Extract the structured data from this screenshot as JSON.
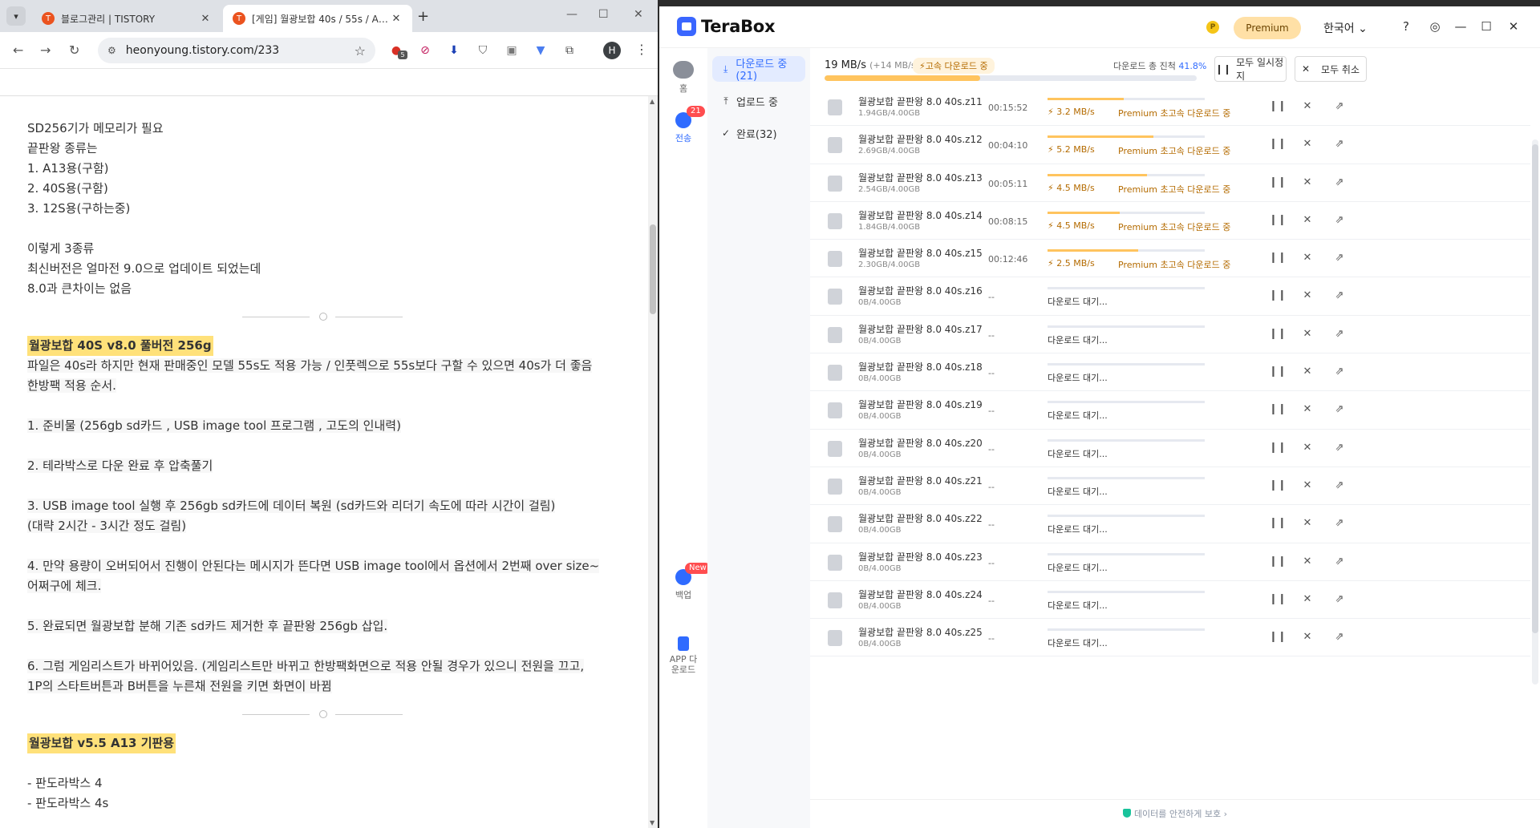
{
  "chrome": {
    "tabs": [
      {
        "label": "블로그관리 | TISTORY",
        "favicon": "T",
        "active": false
      },
      {
        "label": "[게임] 월광보합 40s / 55s / A13 끝판왕 ...",
        "favicon": "T",
        "active": true
      }
    ],
    "url": "heonyoung.tistory.com/233",
    "profile_initial": "H",
    "ext_badge": "5"
  },
  "article": {
    "block1": [
      "SD256기가 메모리가 필요",
      "끝판왕 종류는",
      " 1. A13용(구함)",
      " 2. 40S용(구함)",
      " 3. 12S용(구하는중)",
      "",
      "이렇게 3종류",
      "최신버전은 얼마전 9.0으로 업데이트 되었는데",
      "8.0과 큰차이는 없음"
    ],
    "heading1": "월광보합 40S v8.0 풀버전 256g",
    "block2": [
      "파일은 40s라 하지만 현재 판매중인 모델 55s도 적용 가능 / 인풋렉으로 55s보다 구할 수 있으면 40s가 더 좋음",
      "한방팩 적용 순서.",
      "",
      "1. 준비물 (256gb sd카드 , USB image tool 프로그램 , 고도의 인내력)",
      "",
      "2. 테라박스로 다운 완료 후 압축풀기",
      "",
      "3. USB image tool 실행 후 256gb sd카드에 데이터 복원 (sd카드와 리더기 속도에 따라 시간이 걸림)",
      "(대략 2시간 - 3시간 정도 걸림)",
      "",
      "4. 만약 용량이 오버되어서 진행이 안된다는 메시지가 뜬다면 USB image tool에서 옵션에서 2번째 over size~",
      "어쩌구에 체크.",
      "",
      "5. 완료되면 월광보합 분해 기존 sd카드 제거한 후 끝판왕 256gb 삽입.",
      "",
      "6. 그럼 게임리스트가 바뀌어있음. (게임리스트만 바뀌고 한방팩화면으로 적용 안될 경우가 있으니 전원을 끄고,",
      "1P의 스타트버튼과 B버튼을 누른채 전원을 키면 화면이 바뀜"
    ],
    "heading2": "월광보합 v5.5 A13 기판용",
    "block3": [
      " - 판도라박스 4",
      " - 판도라박스 4s"
    ]
  },
  "terabox": {
    "app_name": "TeraBox",
    "coin_label": "P",
    "premium_label": "Premium",
    "language": "한국어",
    "rail": {
      "home": "홈",
      "transfer": "전송",
      "transfer_badge": "21",
      "backup": "백업",
      "backup_badge": "New",
      "app_download": "APP 다운로드"
    },
    "sidebar": {
      "downloading": "다운로드 중(21)",
      "uploading": "업로드 중",
      "completed": "완료(32)"
    },
    "summary": {
      "speed": "19 MB/s",
      "speed_extra": "(+14 MB/s)",
      "fast_tag": "고속 다운로드 중",
      "progress_text": "다운로드 총 진척",
      "progress_pct": "41.8%",
      "progress_value": 0.418,
      "pause_all": "모두 일시정지",
      "cancel_all": "모두 취소"
    },
    "downloads": [
      {
        "name": "월광보합 끝판왕 8.0 40s.z11",
        "size": "1.94GB/4.00GB",
        "time": "00:15:52",
        "progress": 0.485,
        "speed": "3.2 MB/s",
        "status": "Premium 초고속 다운로드 중"
      },
      {
        "name": "월광보합 끝판왕 8.0 40s.z12",
        "size": "2.69GB/4.00GB",
        "time": "00:04:10",
        "progress": 0.672,
        "speed": "5.2 MB/s",
        "status": "Premium 초고속 다운로드 중"
      },
      {
        "name": "월광보합 끝판왕 8.0 40s.z13",
        "size": "2.54GB/4.00GB",
        "time": "00:05:11",
        "progress": 0.635,
        "speed": "4.5 MB/s",
        "status": "Premium 초고속 다운로드 중"
      },
      {
        "name": "월광보합 끝판왕 8.0 40s.z14",
        "size": "1.84GB/4.00GB",
        "time": "00:08:15",
        "progress": 0.46,
        "speed": "4.5 MB/s",
        "status": "Premium 초고속 다운로드 중"
      },
      {
        "name": "월광보합 끝판왕 8.0 40s.z15",
        "size": "2.30GB/4.00GB",
        "time": "00:12:46",
        "progress": 0.575,
        "speed": "2.5 MB/s",
        "status": "Premium 초고속 다운로드 중"
      },
      {
        "name": "월광보합 끝판왕 8.0 40s.z16",
        "size": "0B/4.00GB",
        "time": "--",
        "progress": 0,
        "wait": "다운로드 대기..."
      },
      {
        "name": "월광보합 끝판왕 8.0 40s.z17",
        "size": "0B/4.00GB",
        "time": "--",
        "progress": 0,
        "wait": "다운로드 대기..."
      },
      {
        "name": "월광보합 끝판왕 8.0 40s.z18",
        "size": "0B/4.00GB",
        "time": "--",
        "progress": 0,
        "wait": "다운로드 대기..."
      },
      {
        "name": "월광보합 끝판왕 8.0 40s.z19",
        "size": "0B/4.00GB",
        "time": "--",
        "progress": 0,
        "wait": "다운로드 대기..."
      },
      {
        "name": "월광보합 끝판왕 8.0 40s.z20",
        "size": "0B/4.00GB",
        "time": "--",
        "progress": 0,
        "wait": "다운로드 대기..."
      },
      {
        "name": "월광보합 끝판왕 8.0 40s.z21",
        "size": "0B/4.00GB",
        "time": "--",
        "progress": 0,
        "wait": "다운로드 대기..."
      },
      {
        "name": "월광보합 끝판왕 8.0 40s.z22",
        "size": "0B/4.00GB",
        "time": "--",
        "progress": 0,
        "wait": "다운로드 대기..."
      },
      {
        "name": "월광보합 끝판왕 8.0 40s.z23",
        "size": "0B/4.00GB",
        "time": "--",
        "progress": 0,
        "wait": "다운로드 대기..."
      },
      {
        "name": "월광보합 끝판왕 8.0 40s.z24",
        "size": "0B/4.00GB",
        "time": "--",
        "progress": 0,
        "wait": "다운로드 대기..."
      },
      {
        "name": "월광보합 끝판왕 8.0 40s.z25",
        "size": "0B/4.00GB",
        "time": "--",
        "progress": 0,
        "wait": "다운로드 대기..."
      }
    ],
    "footer": "데이터를 안전하게 보호"
  },
  "colors": {
    "accent": "#2f6bff",
    "progress": "#ffc45e",
    "premium": "#b46b00",
    "highlight": "#ffe17a"
  }
}
